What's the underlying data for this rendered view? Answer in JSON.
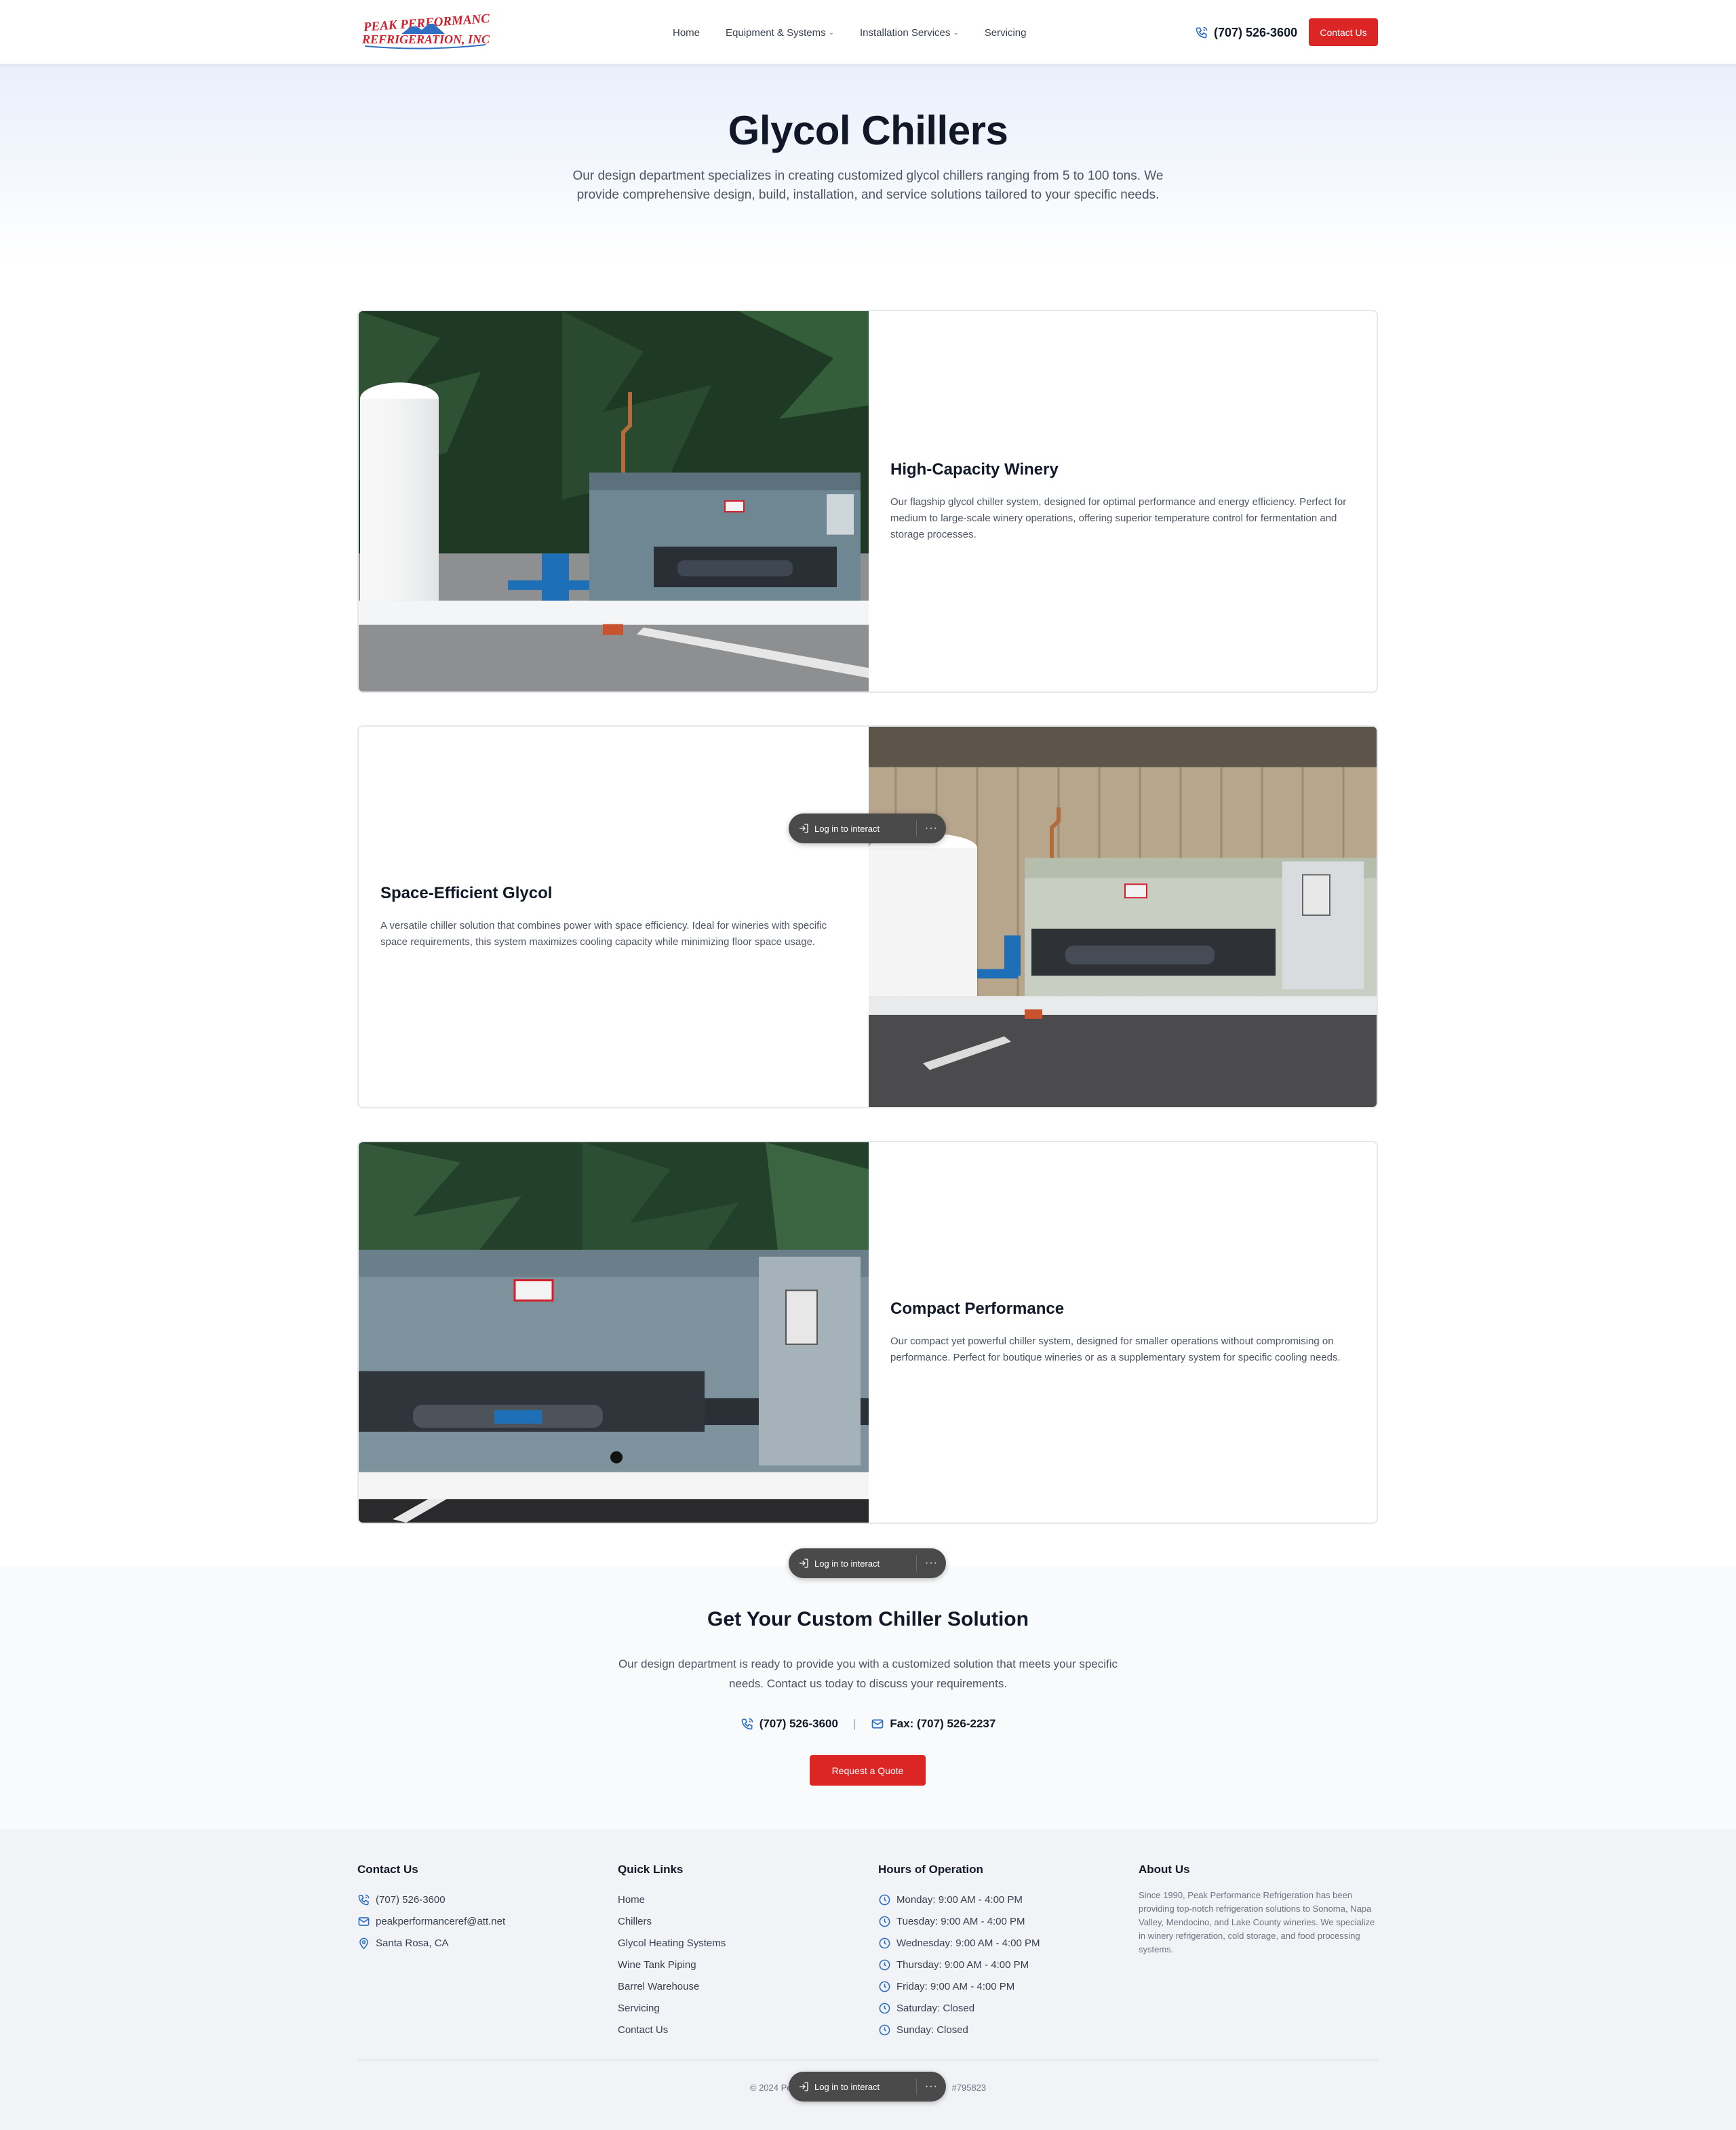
{
  "brand": {
    "name_line1": "Peak Performance",
    "name_line2": "Refrigeration, Inc.",
    "red": "#d21f2b",
    "blue": "#2f6fc2"
  },
  "header": {
    "nav": [
      {
        "label": "Home",
        "dropdown": false
      },
      {
        "label": "Equipment & Systems",
        "dropdown": true
      },
      {
        "label": "Installation Services",
        "dropdown": true
      },
      {
        "label": "Servicing",
        "dropdown": false
      }
    ],
    "phone": "(707) 526-3600",
    "contact_label": "Contact Us"
  },
  "hero": {
    "title": "Glycol Chillers",
    "subtitle": "Our design department specializes in creating customized glycol chillers ranging from 5 to 100 tons. We provide comprehensive design, build, installation, and service solutions tailored to your specific needs."
  },
  "products": [
    {
      "title": "High-Capacity Winery",
      "description": "Our flagship glycol chiller system, designed for optimal performance and energy efficiency. Perfect for medium to large-scale winery operations, offering superior temperature control for fermentation and storage processes."
    },
    {
      "title": "Space-Efficient Glycol",
      "description": "A versatile chiller solution that combines power with space efficiency. Ideal for wineries with specific space requirements, this system maximizes cooling capacity while minimizing floor space usage."
    },
    {
      "title": "Compact Performance",
      "description": "Our compact yet powerful chiller system, designed for smaller operations without compromising on performance. Perfect for boutique wineries or as a supplementary system for specific cooling needs."
    }
  ],
  "cta": {
    "title": "Get Your Custom Chiller Solution",
    "text": "Our design department is ready to provide you with a customized solution that meets your specific needs. Contact us today to discuss your requirements.",
    "phone": "(707) 526-3600",
    "separator": "|",
    "fax": "Fax: (707) 526-2237",
    "button_label": "Request a Quote"
  },
  "footer": {
    "contact": {
      "title": "Contact Us",
      "phone": "(707) 526-3600",
      "email": "peakperformanceref@att.net",
      "location": "Santa Rosa, CA"
    },
    "quick_links": {
      "title": "Quick Links",
      "links": [
        "Home",
        "Chillers",
        "Glycol Heating Systems",
        "Wine Tank Piping",
        "Barrel Warehouse",
        "Servicing",
        "Contact Us"
      ]
    },
    "hours": {
      "title": "Hours of Operation",
      "days": [
        "Monday: 9:00 AM - 4:00 PM",
        "Tuesday: 9:00 AM - 4:00 PM",
        "Wednesday: 9:00 AM - 4:00 PM",
        "Thursday: 9:00 AM - 4:00 PM",
        "Friday: 9:00 AM - 4:00 PM",
        "Saturday: Closed",
        "Sunday: Closed"
      ]
    },
    "about": {
      "title": "About Us",
      "text": "Since 1990, Peak Performance Refrigeration has been providing top-notch refrigeration solutions to Sonoma, Napa Valley, Mendocino, and Lake County wineries. We specialize in winery refrigeration, cold storage, and food processing systems."
    },
    "copyright_left": "© 2024 Pe",
    "copyright_right": "#795823"
  },
  "overlay": {
    "label": "Log in to interact",
    "more": "···"
  },
  "icons": {
    "phone": "phone-icon",
    "mail": "mail-icon",
    "pin": "map-pin-icon",
    "clock": "clock-icon",
    "login": "login-arrow-icon",
    "more": "more-dots-icon"
  }
}
